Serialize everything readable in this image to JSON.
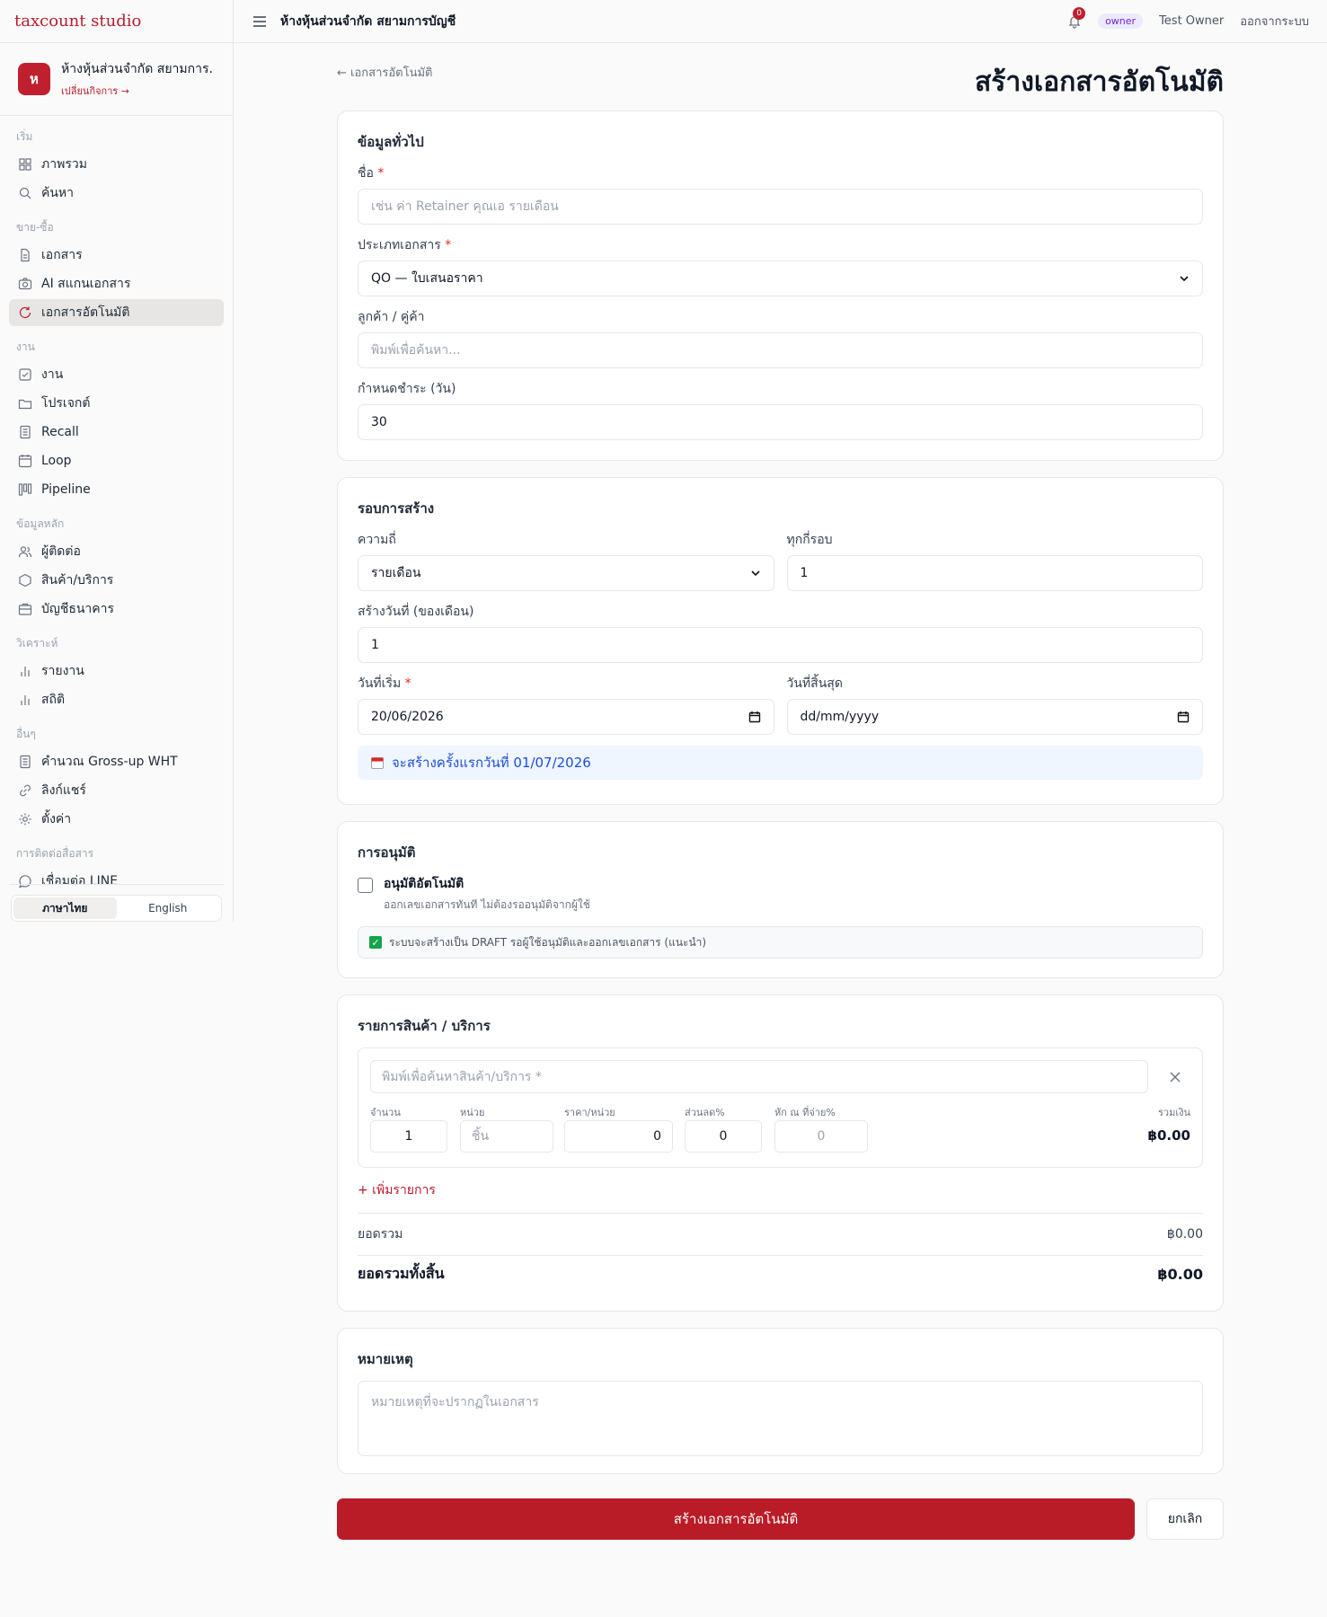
{
  "app": {
    "brand": "taxcount studio"
  },
  "business": {
    "initial": "ห",
    "name": "ห้างหุ้นส่วนจำกัด สยามการ...",
    "switch_label": "เปลี่ยนกิจการ →"
  },
  "sidebar": {
    "groups": [
      {
        "label": "เริ่ม",
        "items": [
          {
            "label": "ภาพรวม",
            "icon": "grid-icon"
          },
          {
            "label": "ค้นหา",
            "icon": "search-icon"
          }
        ]
      },
      {
        "label": "ขาย-ซื้อ",
        "items": [
          {
            "label": "เอกสาร",
            "icon": "document-icon"
          },
          {
            "label": "AI สแกนเอกสาร",
            "icon": "camera-icon"
          },
          {
            "label": "เอกสารอัตโนมัติ",
            "icon": "refresh-icon",
            "active": true
          }
        ]
      },
      {
        "label": "งาน",
        "items": [
          {
            "label": "งาน",
            "icon": "checkbox-icon"
          },
          {
            "label": "โปรเจกต์",
            "icon": "folder-icon"
          },
          {
            "label": "Recall",
            "icon": "list-icon"
          },
          {
            "label": "Loop",
            "icon": "calendar-icon"
          },
          {
            "label": "Pipeline",
            "icon": "kanban-icon"
          }
        ]
      },
      {
        "label": "ข้อมูลหลัก",
        "items": [
          {
            "label": "ผู้ติดต่อ",
            "icon": "users-icon"
          },
          {
            "label": "สินค้า/บริการ",
            "icon": "box-icon"
          },
          {
            "label": "บัญชีธนาคาร",
            "icon": "bank-icon"
          }
        ]
      },
      {
        "label": "วิเคราะห์",
        "items": [
          {
            "label": "รายงาน",
            "icon": "bar-chart-icon"
          },
          {
            "label": "สถิติ",
            "icon": "bar-chart-icon"
          }
        ]
      },
      {
        "label": "อื่นๆ",
        "items": [
          {
            "label": "คำนวณ Gross-up WHT",
            "icon": "calculator-icon"
          },
          {
            "label": "ลิงก์แชร์",
            "icon": "link-icon"
          },
          {
            "label": "ตั้งค่า",
            "icon": "gear-icon"
          }
        ]
      },
      {
        "label": "การติดต่อสื่อสาร",
        "items": [
          {
            "label": "เชื่อมต่อ LINE",
            "icon": "chat-icon"
          }
        ]
      }
    ],
    "lang_th": "ภาษาไทย",
    "lang_en": "English"
  },
  "topbar": {
    "title": "ห้างหุ้นส่วนจำกัด สยามการบัญชี",
    "notif_count": "0",
    "role": "owner",
    "user": "Test Owner",
    "logout": "ออกจากระบบ"
  },
  "page": {
    "back": "← เอกสารอัตโนมัติ",
    "title": "สร้างเอกสารอัตโนมัติ"
  },
  "general": {
    "heading": "ข้อมูลทั่วไป",
    "name_label": "ชื่อ",
    "name_placeholder": "เช่น ค่า Retainer คุณเอ รายเดือน",
    "doctype_label": "ประเภทเอกสาร",
    "doctype_value": "QO — ใบเสนอราคา",
    "customer_label": "ลูกค้า / คู่ค้า",
    "customer_placeholder": "พิมพ์เพื่อค้นหา...",
    "due_label": "กำหนดชำระ (วัน)",
    "due_value": "30"
  },
  "schedule": {
    "heading": "รอบการสร้าง",
    "freq_label": "ความถี่",
    "freq_value": "รายเดือน",
    "every_label": "ทุกกี่รอบ",
    "every_value": "1",
    "day_label": "สร้างวันที่ (ของเดือน)",
    "day_value": "1",
    "start_label": "วันที่เริ่ม",
    "start_value": "20/06/2026",
    "end_label": "วันที่สิ้นสุด",
    "end_value": "dd/mm/yyyy",
    "info": "จะสร้างครั้งแรกวันที่ 01/07/2026"
  },
  "approval": {
    "heading": "การอนุมัติ",
    "auto_label": "อนุมัติอัตโนมัติ",
    "auto_desc": "ออกเลขเอกสารทันที ไม่ต้องรออนุมัติจากผู้ใช้",
    "auto_checked": false,
    "note": "ระบบจะสร้างเป็น DRAFT รอผู้ใช้อนุมัติและออกเลขเอกสาร (แนะนำ)"
  },
  "items": {
    "heading": "รายการสินค้า / บริการ",
    "search_placeholder": "พิมพ์เพื่อค้นหาสินค้า/บริการ *",
    "col_qty": "จำนวน",
    "col_unit": "หน่วย",
    "col_price": "ราคา/หน่วย",
    "col_discount": "ส่วนลด%",
    "col_wht": "หัก ณ ที่จ่าย%",
    "col_total": "รวมเงิน",
    "qty": "1",
    "unit_placeholder": "ชิ้น",
    "price": "0",
    "discount": "0",
    "wht_placeholder": "0",
    "line_total": "฿0.00",
    "add_label": "+ เพิ่มรายการ",
    "subtotal_label": "ยอดรวม",
    "subtotal": "฿0.00",
    "grand_label": "ยอดรวมทั้งสิ้น",
    "grand": "฿0.00"
  },
  "notes": {
    "heading": "หมายเหตุ",
    "placeholder": "หมายเหตุที่จะปรากฏในเอกสาร"
  },
  "actions": {
    "submit": "สร้างเอกสารอัตโนมัติ",
    "cancel": "ยกเลิก"
  }
}
